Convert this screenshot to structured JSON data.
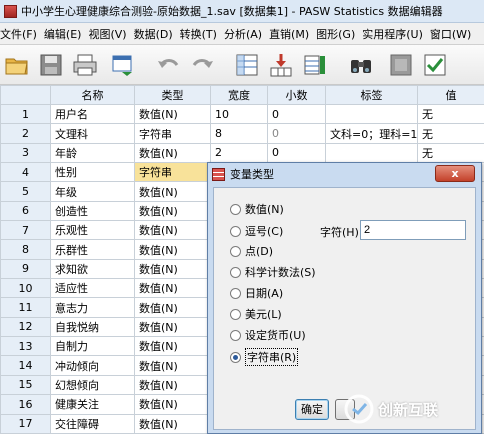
{
  "window": {
    "title": "中小学生心理健康综合测验-原始数据_1.sav [数据集1] - PASW Statistics 数据编辑器"
  },
  "menu": [
    "文件(F)",
    "编辑(E)",
    "视图(V)",
    "数据(D)",
    "转换(T)",
    "分析(A)",
    "直销(M)",
    "图形(G)",
    "实用程序(U)",
    "窗口(W)"
  ],
  "toolbar": [
    "open-folder-icon",
    "save-icon",
    "print-icon",
    "dialog-recall-icon",
    "undo-icon",
    "redo-icon",
    "goto-case-icon",
    "goto-variable-icon",
    "variables-icon",
    "find-icon",
    "insert-cases-icon",
    "split-file-icon"
  ],
  "grid": {
    "headers": [
      "",
      "名称",
      "类型",
      "宽度",
      "小数",
      "标签",
      "值"
    ],
    "rows": [
      {
        "num": "1",
        "name": "用户名",
        "type": "数值(N)",
        "width": "10",
        "decimals": "0",
        "label": "",
        "values": "无"
      },
      {
        "num": "2",
        "name": "文理科",
        "type": "字符串",
        "width": "8",
        "decimals": "0",
        "label": "文科=0；理科=1",
        "values": "无"
      },
      {
        "num": "3",
        "name": "年龄",
        "type": "数值(N)",
        "width": "2",
        "decimals": "0",
        "label": "",
        "values": "无"
      },
      {
        "num": "4",
        "name": "性别",
        "type": "字符串",
        "width": "",
        "decimals": "",
        "label": "",
        "values": ""
      },
      {
        "num": "5",
        "name": "年级",
        "type": "数值(N)",
        "width": "",
        "decimals": "",
        "label": "",
        "values": ""
      },
      {
        "num": "6",
        "name": "创造性",
        "type": "数值(N)",
        "width": "",
        "decimals": "",
        "label": "",
        "values": ""
      },
      {
        "num": "7",
        "name": "乐观性",
        "type": "数值(N)",
        "width": "",
        "decimals": "",
        "label": "",
        "values": ""
      },
      {
        "num": "8",
        "name": "乐群性",
        "type": "数值(N)",
        "width": "",
        "decimals": "",
        "label": "",
        "values": ""
      },
      {
        "num": "9",
        "name": "求知欲",
        "type": "数值(N)",
        "width": "",
        "decimals": "",
        "label": "",
        "values": ""
      },
      {
        "num": "10",
        "name": "适应性",
        "type": "数值(N)",
        "width": "",
        "decimals": "",
        "label": "",
        "values": ""
      },
      {
        "num": "11",
        "name": "意志力",
        "type": "数值(N)",
        "width": "",
        "decimals": "",
        "label": "",
        "values": ""
      },
      {
        "num": "12",
        "name": "自我悦纳",
        "type": "数值(N)",
        "width": "",
        "decimals": "",
        "label": "",
        "values": ""
      },
      {
        "num": "13",
        "name": "自制力",
        "type": "数值(N)",
        "width": "",
        "decimals": "",
        "label": "",
        "values": ""
      },
      {
        "num": "14",
        "name": "冲动倾向",
        "type": "数值(N)",
        "width": "",
        "decimals": "",
        "label": "",
        "values": ""
      },
      {
        "num": "15",
        "name": "幻想倾向",
        "type": "数值(N)",
        "width": "",
        "decimals": "",
        "label": "",
        "values": ""
      },
      {
        "num": "16",
        "name": "健康关注",
        "type": "数值(N)",
        "width": "",
        "decimals": "",
        "label": "",
        "values": ""
      },
      {
        "num": "17",
        "name": "交往障碍",
        "type": "数值(N)",
        "width": "",
        "decimals": "",
        "label": "",
        "values": ""
      }
    ]
  },
  "dialog": {
    "title": "变量类型",
    "close": "x",
    "options": [
      "数值(N)",
      "逗号(C)",
      "点(D)",
      "科学计数法(S)",
      "日期(A)",
      "美元(L)",
      "设定货币(U)",
      "字符串(R)"
    ],
    "selected": "字符串(R)",
    "chars_label": "字符(H):",
    "chars_value": "2",
    "ok": "确定"
  },
  "watermark": {
    "text": "创新互联"
  },
  "colors": {
    "selected_cell": "#f8e29a",
    "dialog_frame": "#c9dbf0",
    "header": "#e6eef7"
  }
}
